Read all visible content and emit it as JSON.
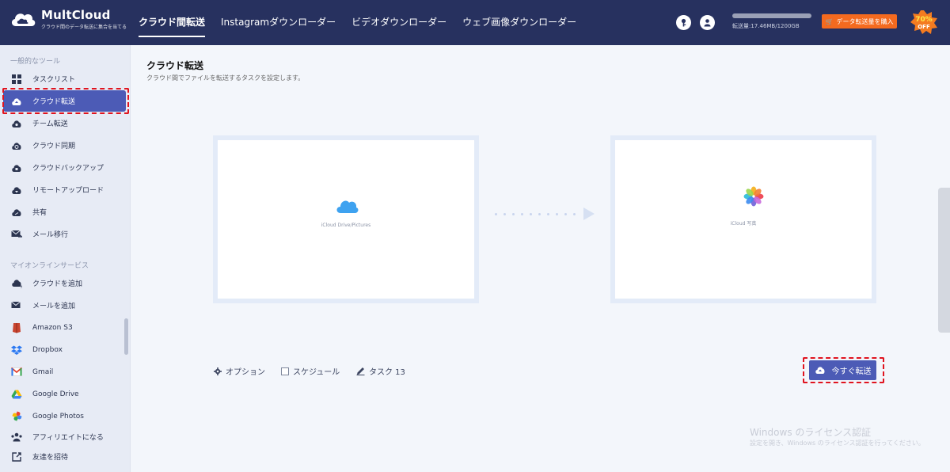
{
  "brand": {
    "name": "MultCloud",
    "tagline": "クラウド間のデータ転送に集合を当てる"
  },
  "nav": {
    "items": [
      {
        "label": "クラウド間転送",
        "active": true
      },
      {
        "label": "Instagramダウンローダー",
        "active": false
      },
      {
        "label": "ビデオダウンローダー",
        "active": false
      },
      {
        "label": "ウェブ画像ダウンローダー",
        "active": false
      }
    ]
  },
  "header": {
    "usage_text": "転送量:17.46MB/1200GB",
    "buy_label": "データ転送量を購入",
    "promo_percent": "70%",
    "promo_off": "OFF"
  },
  "sidebar": {
    "section_tools": "一般的なツール",
    "tools": [
      {
        "label": "タスクリスト",
        "icon": "grid-icon"
      },
      {
        "label": "クラウド転送",
        "icon": "cloud-transfer-icon",
        "active": true
      },
      {
        "label": "チーム転送",
        "icon": "team-transfer-icon"
      },
      {
        "label": "クラウド同期",
        "icon": "cloud-sync-icon"
      },
      {
        "label": "クラウドバックアップ",
        "icon": "cloud-backup-icon"
      },
      {
        "label": "リモートアップロード",
        "icon": "remote-upload-icon"
      },
      {
        "label": "共有",
        "icon": "share-icon"
      },
      {
        "label": "メール移行",
        "icon": "email-migration-icon"
      }
    ],
    "section_services": "マイオンラインサービス",
    "services": [
      {
        "label": "クラウドを追加",
        "icon": "add-cloud-icon"
      },
      {
        "label": "メールを追加",
        "icon": "add-email-icon"
      },
      {
        "label": "Amazon S3",
        "icon": "amazon-s3-icon"
      },
      {
        "label": "Dropbox",
        "icon": "dropbox-icon"
      },
      {
        "label": "Gmail",
        "icon": "gmail-icon"
      },
      {
        "label": "Google Drive",
        "icon": "google-drive-icon"
      },
      {
        "label": "Google Photos",
        "icon": "google-photos-icon"
      }
    ],
    "affiliate": "アフィリエイトになる",
    "invite": "友達を招待"
  },
  "main": {
    "title": "クラウド転送",
    "subtitle": "クラウド間でファイルを転送するタスクを設定します。",
    "source_label": "iCloud Drive/Pictures",
    "target_label": "iCloud 写真",
    "option_label": "オプション",
    "schedule_label": "スケジュール",
    "task_label": "タスク 13",
    "transfer_now": "今すぐ転送"
  },
  "watermark": {
    "title": "Windows のライセンス認証",
    "subtitle": "設定を開き、Windows のライセンス認証を行ってください。"
  }
}
